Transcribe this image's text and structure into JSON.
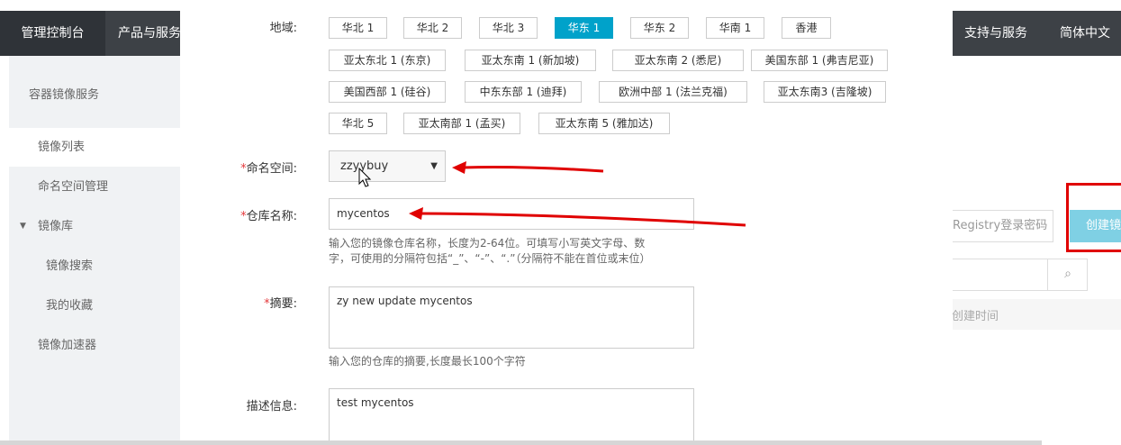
{
  "topbar": {
    "console": "管理控制台",
    "products": "产品与服务",
    "support": "支持与服务",
    "language": "简体中文"
  },
  "sidebar": {
    "service_title": "容器镜像服务",
    "items": [
      {
        "label": "镜像列表"
      },
      {
        "label": "命名空间管理"
      },
      {
        "label": "镜像库"
      },
      {
        "label": "镜像搜索"
      },
      {
        "label": "我的收藏"
      },
      {
        "label": "镜像加速器"
      }
    ]
  },
  "background": {
    "registry_password": "Registry登录密码",
    "create_button": "创建镜",
    "created_time": "创建时间"
  },
  "form": {
    "region_label": "地域:",
    "regions": [
      "华北 1",
      "华北 2",
      "华北 3",
      "华东 1",
      "华东 2",
      "华南 1",
      "香港",
      "亚太东北 1 (东京)",
      "亚太东南 1 (新加坡)",
      "亚太东南 2 (悉尼)",
      "美国东部 1 (弗吉尼亚)",
      "美国西部 1 (硅谷)",
      "中东东部 1 (迪拜)",
      "欧洲中部 1 (法兰克福)",
      "亚太东南3 (吉隆坡)",
      "华北 5",
      "亚太南部 1 (孟买)",
      "亚太东南 5 (雅加达)"
    ],
    "selected_region": "华东 1",
    "namespace_label": "命名空间:",
    "namespace_value": "zzyybuy",
    "repo_label": "仓库名称:",
    "repo_value": "mycentos",
    "repo_hint_1": "输入您的镜像仓库名称，长度为2-64位。可填写小写英文字母、数",
    "repo_hint_2": "字，可使用的分隔符包括“_”、“-”、“.”（分隔符不能在首位或末位）",
    "summary_label": "摘要:",
    "summary_value": "zy new update mycentos",
    "summary_hint": "输入您的仓库的摘要,长度最长100个字符",
    "description_label": "描述信息:",
    "description_value": "test mycentos",
    "required_mark": "*"
  },
  "colors": {
    "topbar": "#3d4146",
    "selected_region": "#00a2ca",
    "annotation_red": "#e00000"
  }
}
